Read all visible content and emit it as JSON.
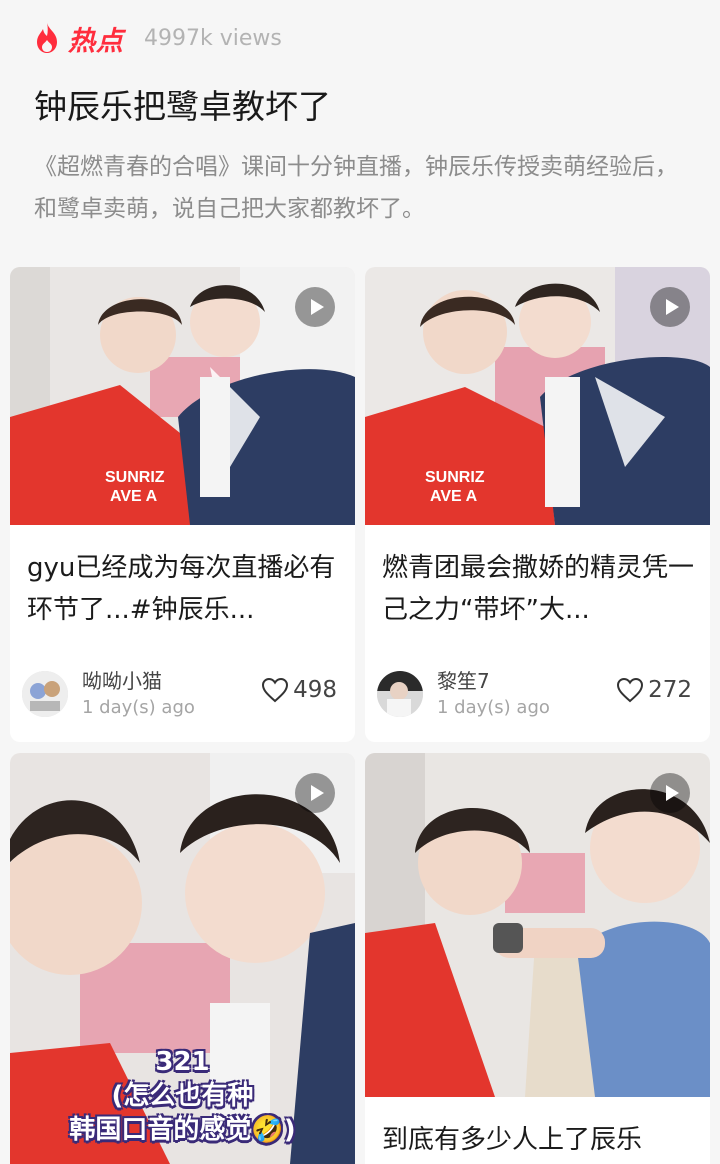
{
  "topic": {
    "hot_label": "热点",
    "views": "4997k views",
    "title": "钟辰乐把鹭卓教坏了",
    "description": "《超燃青春的合唱》课间十分钟直播，钟辰乐传授卖萌经验后，和鹭卓卖萌，说自己把大家都教坏了。"
  },
  "icons": {
    "hot": "flame-icon",
    "play": "play-icon",
    "like": "heart-icon"
  },
  "colors": {
    "accent": "#ff2d3d",
    "background": "#f6f6f6",
    "card": "#ffffff"
  },
  "cards": [
    {
      "title": "gyu已经成为每次直播必有环节了...#钟辰乐...",
      "author": "呦呦小猫",
      "time": "1 day(s) ago",
      "likes": "498"
    },
    {
      "title": "燃青团最会撒娇的精灵凭一己之力“带坏”大...",
      "author": "黎笙7",
      "time": "1 day(s) ago",
      "likes": "272"
    },
    {
      "caption": "321\n(怎么也有种\n韩国口音的感觉🤣)"
    },
    {
      "title": "到底有多少人上了辰乐"
    }
  ]
}
